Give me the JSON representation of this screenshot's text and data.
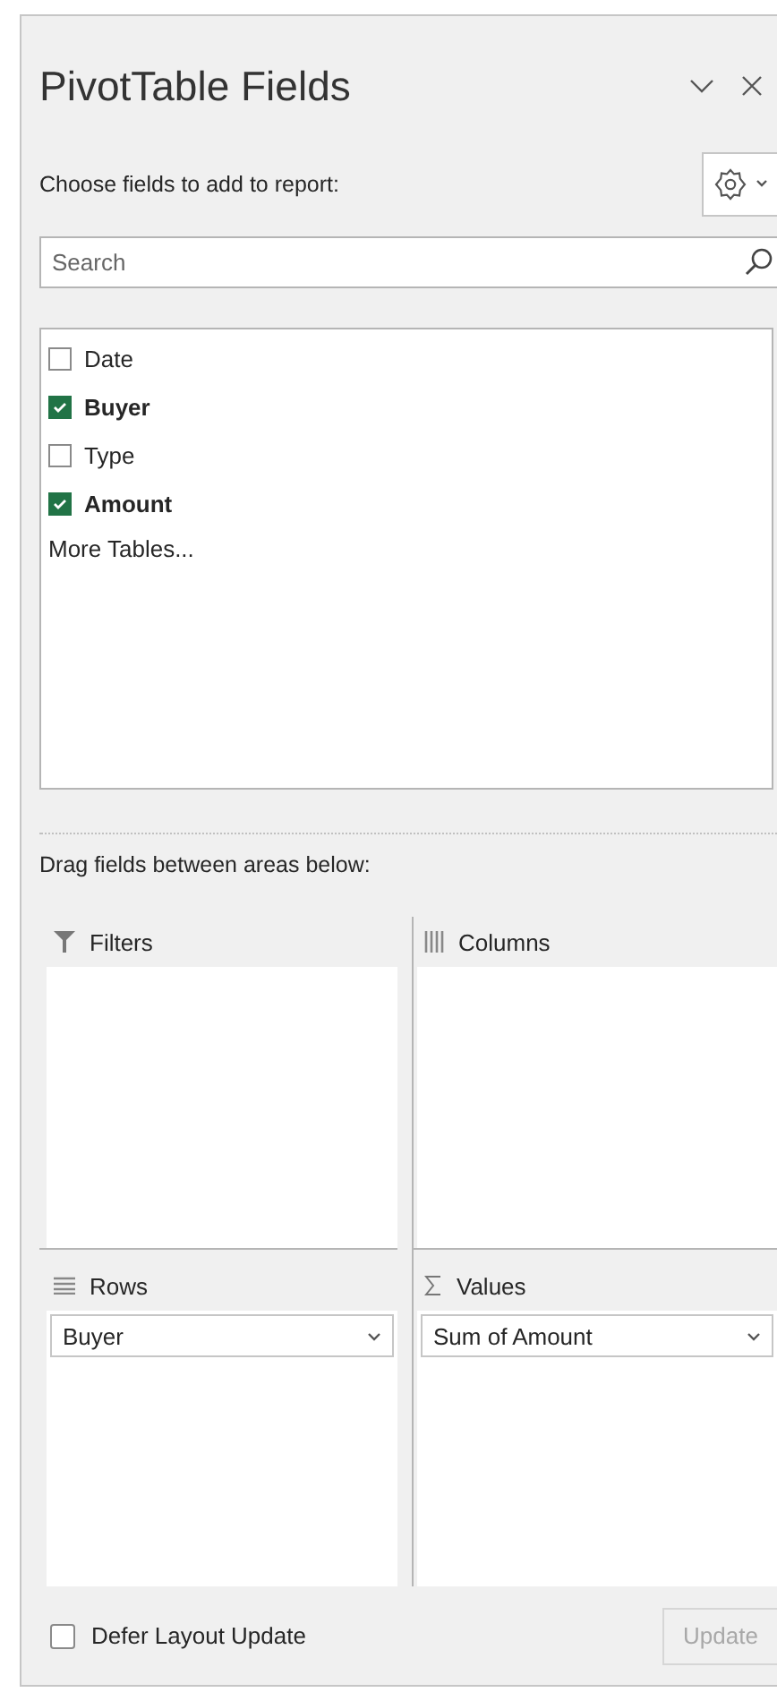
{
  "pane": {
    "title": "PivotTable Fields",
    "subtitle": "Choose fields to add to report:"
  },
  "search": {
    "placeholder": "Search"
  },
  "fields": [
    {
      "label": "Date",
      "checked": false
    },
    {
      "label": "Buyer",
      "checked": true
    },
    {
      "label": "Type",
      "checked": false
    },
    {
      "label": "Amount",
      "checked": true
    }
  ],
  "more_tables": "More Tables...",
  "areas_label": "Drag fields between areas below:",
  "areas": [
    {
      "kind": "filters",
      "title": "Filters"
    },
    {
      "kind": "columns",
      "title": "Columns"
    },
    {
      "kind": "rows",
      "title": "Rows",
      "items": [
        "Buyer"
      ]
    },
    {
      "kind": "values",
      "title": "Values",
      "items": [
        "Sum of Amount"
      ]
    }
  ],
  "defer": {
    "label": "Defer Layout Update",
    "checked": false
  },
  "update_button": {
    "label": "Update",
    "disabled": true
  }
}
